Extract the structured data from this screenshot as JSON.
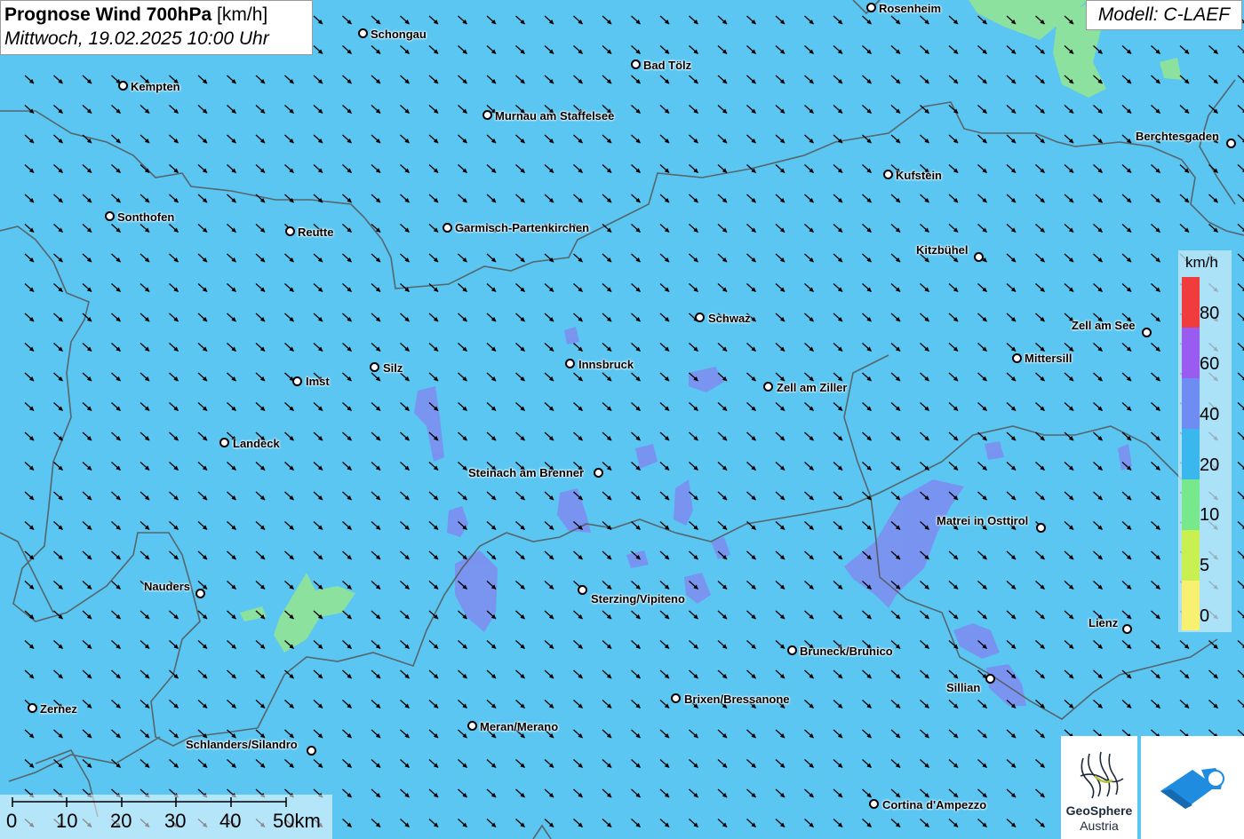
{
  "title": {
    "main": "Prognose Wind 700hPa",
    "unit": "[km/h]",
    "date": "Mittwoch, 19.02.2025 10:00 Uhr"
  },
  "model_label": "Modell: C-LAEF",
  "cities": [
    {
      "name": "Rosenheim"
    },
    {
      "name": "Schongau"
    },
    {
      "name": "Bad Tölz"
    },
    {
      "name": "Kempten"
    },
    {
      "name": "Murnau am Staffelsee"
    },
    {
      "name": "Berchtesgaden"
    },
    {
      "name": "Kufstein"
    },
    {
      "name": "Sonthofen"
    },
    {
      "name": "Reutte"
    },
    {
      "name": "Garmisch-Partenkirchen"
    },
    {
      "name": "Kitzbühel"
    },
    {
      "name": "Schwaz"
    },
    {
      "name": "Zell am See"
    },
    {
      "name": "Mittersill"
    },
    {
      "name": "Silz"
    },
    {
      "name": "Innsbruck"
    },
    {
      "name": "Imst"
    },
    {
      "name": "Zell am Ziller"
    },
    {
      "name": "Landeck"
    },
    {
      "name": "Steinach am Brenner"
    },
    {
      "name": "Matrei in Osttirol"
    },
    {
      "name": "Nauders"
    },
    {
      "name": "Sterzing/Vipiteno"
    },
    {
      "name": "Lienz"
    },
    {
      "name": "Bruneck/Brunico"
    },
    {
      "name": "Sillian"
    },
    {
      "name": "Brixen/Bressanone"
    },
    {
      "name": "Zernez"
    },
    {
      "name": "Meran/Merano"
    },
    {
      "name": "Schlanders/Silandro"
    },
    {
      "name": "Cortina d'Ampezzo"
    }
  ],
  "legend": {
    "title": "km/h",
    "labels": [
      "80",
      "60",
      "40",
      "20",
      "10",
      "5",
      "0"
    ],
    "colors": [
      "#f03c3c",
      "#9a5cf0",
      "#6f8cf2",
      "#3ab8ee",
      "#78e88c",
      "#c8f050",
      "#f8f070"
    ]
  },
  "scale": {
    "labels": [
      "0",
      "10",
      "20",
      "30",
      "40",
      "50km"
    ]
  },
  "logos": {
    "geosphere_line1": "GeoSphere",
    "geosphere_line2": "Austria"
  }
}
